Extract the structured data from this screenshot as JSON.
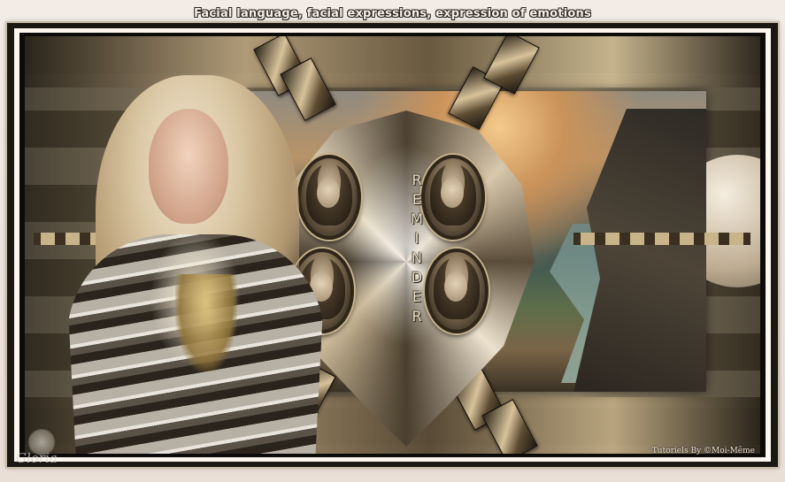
{
  "header": {
    "title": "Facial language, facial expressions, expression of emotions"
  },
  "artwork": {
    "vertical_word_letters": [
      "R",
      "E",
      "M",
      "I",
      "N",
      "D",
      "E",
      "R"
    ],
    "colors": {
      "frame_dark": "#1b1713",
      "frame_light": "#fbf6ef",
      "page_bg": "#ece4dd",
      "gold": "#c7b28c"
    }
  },
  "footer": {
    "credit": "Tutoriels By ©Moi-Même",
    "logo_text": "Gloria"
  }
}
